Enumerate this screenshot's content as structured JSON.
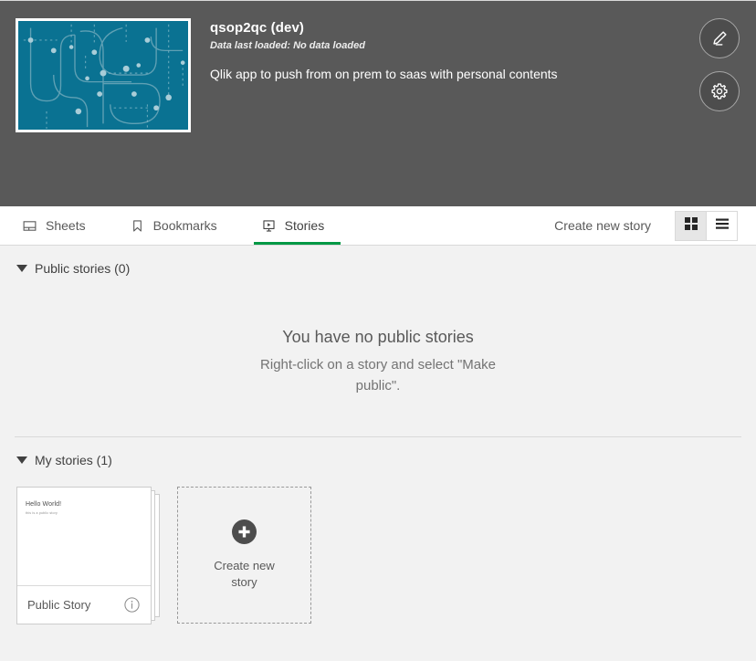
{
  "app": {
    "title": "qsop2qc (dev)",
    "data_status": "Data last loaded: No data loaded",
    "description": "Qlik app to push from on prem to saas with personal contents",
    "thumbnail_bg": "#0a7292",
    "header_bg": "#595959",
    "edit_button_label": "edit",
    "settings_button_label": "app options"
  },
  "tabs": [
    {
      "label": "Sheets",
      "icon": "sheets-icon",
      "active": false
    },
    {
      "label": "Bookmarks",
      "icon": "bookmark-icon",
      "active": false
    },
    {
      "label": "Stories",
      "icon": "story-icon",
      "active": true
    }
  ],
  "toolbar": {
    "create_new_story": "Create new story",
    "grid_view_label": "Grid view",
    "list_view_label": "List view",
    "active_view": "grid",
    "accent_color": "#009845"
  },
  "public_section": {
    "heading": "Public stories (0)",
    "empty_title": "You have no public stories",
    "empty_subtitle": "Right-click on a story and select \"Make public\"."
  },
  "my_section": {
    "heading": "My stories (1)",
    "stories": [
      {
        "name": "Public Story",
        "thumb_title": "Hello World!",
        "thumb_subtitle": "this is a public story",
        "info_label": "info"
      }
    ],
    "create_tile_label": "Create new story"
  }
}
